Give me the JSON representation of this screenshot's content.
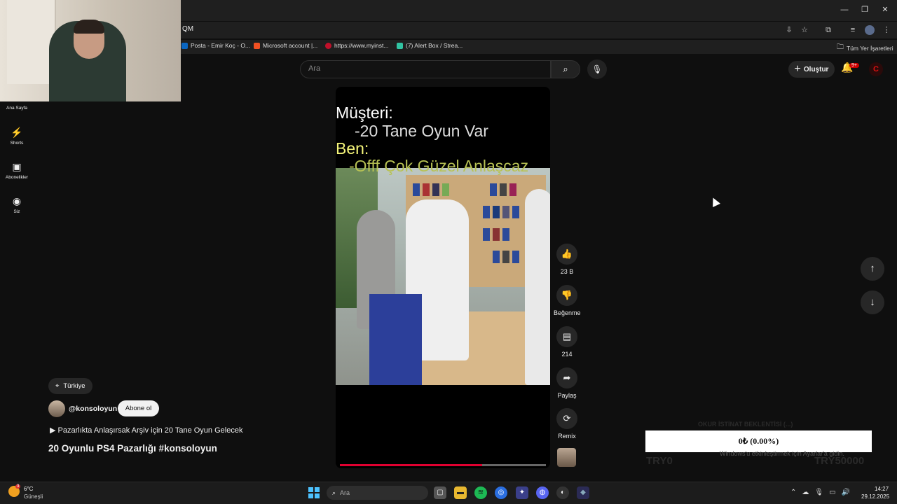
{
  "browser": {
    "url_fragment": "QM",
    "bookmarks": [
      {
        "label": "Posta - Emir Koç - O...",
        "color": "#0a66c2"
      },
      {
        "label": "Microsoft account |...",
        "color": "#f25022"
      },
      {
        "label": "https://www.myinst...",
        "color": "#c0102a"
      },
      {
        "label": "(7) Alert Box / Strea...",
        "color": "#31c3a2"
      }
    ],
    "all_bookmarks": "Tüm Yer İşaretleri"
  },
  "youtube": {
    "search_placeholder": "Ara",
    "create_label": "Oluştur",
    "notif_badge": "9+",
    "nav": [
      {
        "label": "Ana Sayfa",
        "icon": "home-icon"
      },
      {
        "label": "Shorts",
        "icon": "shorts-icon"
      },
      {
        "label": "Abonelikler",
        "icon": "subscriptions-icon"
      },
      {
        "label": "Siz",
        "icon": "account-icon"
      }
    ],
    "video": {
      "caption_line1": "Müşteri:",
      "caption_line2": "-20 Tane Oyun Var",
      "caption_line3": "Ben:",
      "caption_line4": "-Offf Çok Güzel Anlaşcaz",
      "progress": 0.69
    },
    "actions": {
      "like_count": "23 B",
      "dislike_label": "Beğenme",
      "comment_count": "214",
      "share_label": "Paylaş",
      "remix_label": "Remix"
    },
    "meta": {
      "location": "Türkiye",
      "channel": "@konsoloyun",
      "subscribe": "Abone ol",
      "description": "Pazarlıkta Anlaşırsak Arşiv için 20 Tane Oyun Gelecek",
      "title": "20 Oyunlu PS4 Pazarlığı  #konsoloyun"
    }
  },
  "overlay": {
    "goal_ghost": "OKUR İSTİNAT BEKLENTİSİ (...)",
    "donation": "0₺ (0.00%)",
    "left_ghost": "TRY0",
    "right_ghost": "TRY50000",
    "activate_windows": "Windows'u etkinleştirmek için Ayarlar'a gidin."
  },
  "taskbar": {
    "temperature": "6°C",
    "weather": "Güneşli",
    "weather_badge": "3",
    "search_placeholder": "Ara",
    "time": "14:27",
    "date": "29.12.2025"
  }
}
